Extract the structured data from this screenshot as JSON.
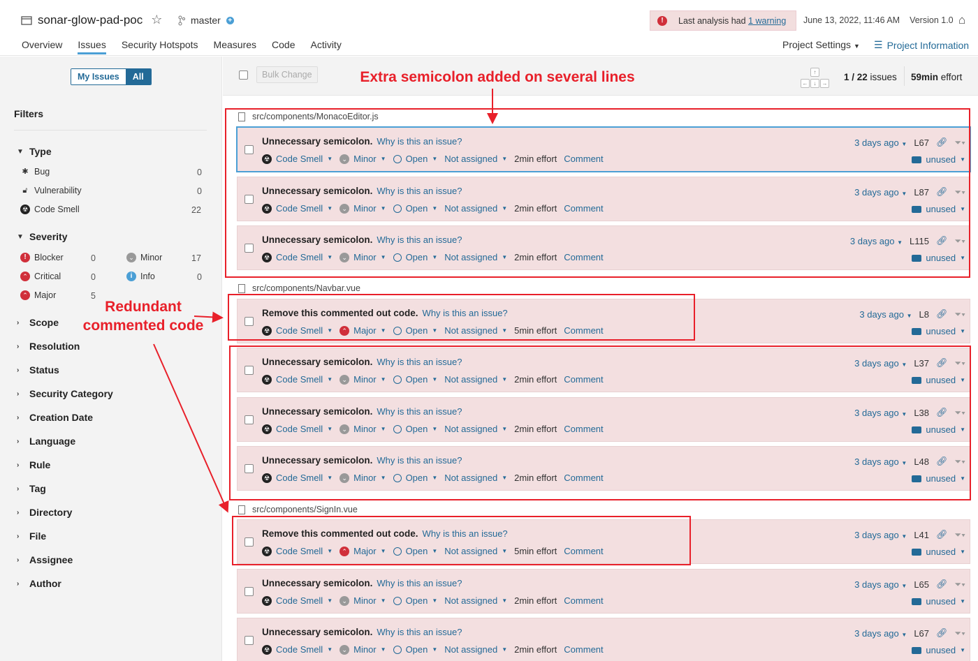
{
  "header": {
    "project_name": "sonar-glow-pad-poc",
    "branch": "master",
    "warning_prefix": "Last analysis had",
    "warning_link": "1 warning",
    "date": "June 13, 2022, 11:46 AM",
    "version": "Version 1.0",
    "tabs": [
      "Overview",
      "Issues",
      "Security Hotspots",
      "Measures",
      "Code",
      "Activity"
    ],
    "active_tab": "Issues",
    "project_settings": "Project Settings",
    "project_information": "Project Information"
  },
  "sidebar": {
    "my_issues": "My Issues",
    "all": "All",
    "filters_title": "Filters",
    "type_title": "Type",
    "types": [
      {
        "label": "Bug",
        "count": "0"
      },
      {
        "label": "Vulnerability",
        "count": "0"
      },
      {
        "label": "Code Smell",
        "count": "22"
      }
    ],
    "severity_title": "Severity",
    "severities": [
      {
        "label": "Blocker",
        "count": "0"
      },
      {
        "label": "Minor",
        "count": "17"
      },
      {
        "label": "Critical",
        "count": "0"
      },
      {
        "label": "Info",
        "count": "0"
      },
      {
        "label": "Major",
        "count": "5"
      }
    ],
    "facets": [
      "Scope",
      "Resolution",
      "Status",
      "Security Category",
      "Creation Date",
      "Language",
      "Rule",
      "Tag",
      "Directory",
      "File",
      "Assignee",
      "Author"
    ]
  },
  "toolbar": {
    "bulk_change": "Bulk Change",
    "issue_position": "1 / 22",
    "issues_word": "issues",
    "effort_value": "59min",
    "effort_word": "effort"
  },
  "files": [
    "src/components/MonacoEditor.js",
    "src/components/Navbar.vue",
    "src/components/SignIn.vue"
  ],
  "common": {
    "why": "Why is this an issue?",
    "type": "Code Smell",
    "status": "Open",
    "assignee": "Not assigned",
    "comment": "Comment",
    "tag": "unused",
    "ago": "3 days ago"
  },
  "issues": [
    {
      "msg": "Unnecessary semicolon.",
      "severity": "Minor",
      "effort": "2min effort",
      "line": "L67"
    },
    {
      "msg": "Unnecessary semicolon.",
      "severity": "Minor",
      "effort": "2min effort",
      "line": "L87"
    },
    {
      "msg": "Unnecessary semicolon.",
      "severity": "Minor",
      "effort": "2min effort",
      "line": "L115"
    },
    {
      "msg": "Remove this commented out code.",
      "severity": "Major",
      "effort": "5min effort",
      "line": "L8"
    },
    {
      "msg": "Unnecessary semicolon.",
      "severity": "Minor",
      "effort": "2min effort",
      "line": "L37"
    },
    {
      "msg": "Unnecessary semicolon.",
      "severity": "Minor",
      "effort": "2min effort",
      "line": "L38"
    },
    {
      "msg": "Unnecessary semicolon.",
      "severity": "Minor",
      "effort": "2min effort",
      "line": "L48"
    },
    {
      "msg": "Remove this commented out code.",
      "severity": "Major",
      "effort": "5min effort",
      "line": "L41"
    },
    {
      "msg": "Unnecessary semicolon.",
      "severity": "Minor",
      "effort": "2min effort",
      "line": "L65"
    },
    {
      "msg": "Unnecessary semicolon.",
      "severity": "Minor",
      "effort": "2min effort",
      "line": "L67"
    }
  ],
  "annotations": {
    "semicolon_note": "Extra semicolon added on several lines",
    "redundant_line1": "Redundant",
    "redundant_line2": "commented code",
    "accent": "#e8202a"
  }
}
